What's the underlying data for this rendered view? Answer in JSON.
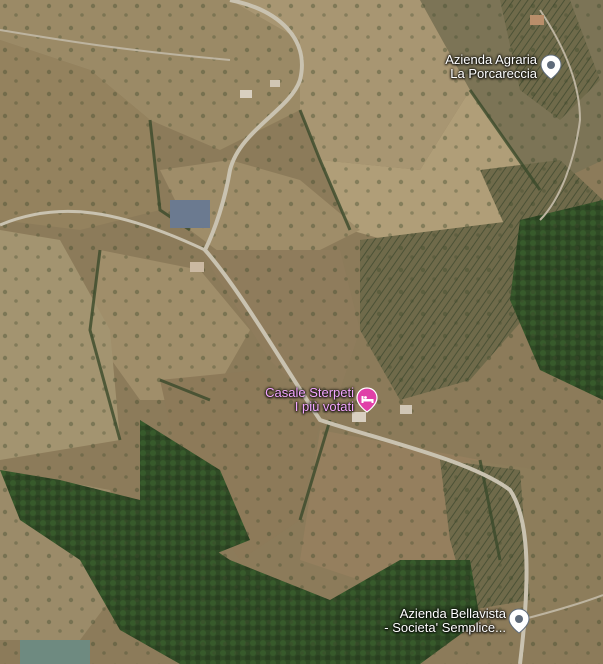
{
  "map": {
    "type": "satellite",
    "colors": {
      "hotel_pin": "#e040a8",
      "poi_pin": "#ffffff",
      "poi_pin_ring": "#5f6b7a",
      "hotel_label": "#f3a6ff"
    }
  },
  "places": [
    {
      "id": "porcareccia",
      "line1": "Azienda Agraria",
      "line2": "La Porcareccia",
      "icon": "location-pin-icon"
    },
    {
      "id": "casale-sterpeti",
      "line1": "Casale Sterpeti",
      "line2": "I più votati",
      "icon": "hotel-bed-icon"
    },
    {
      "id": "bellavista",
      "line1": "Azienda Bellavista",
      "line2": "- Societa' Semplice...",
      "icon": "location-pin-icon"
    }
  ]
}
